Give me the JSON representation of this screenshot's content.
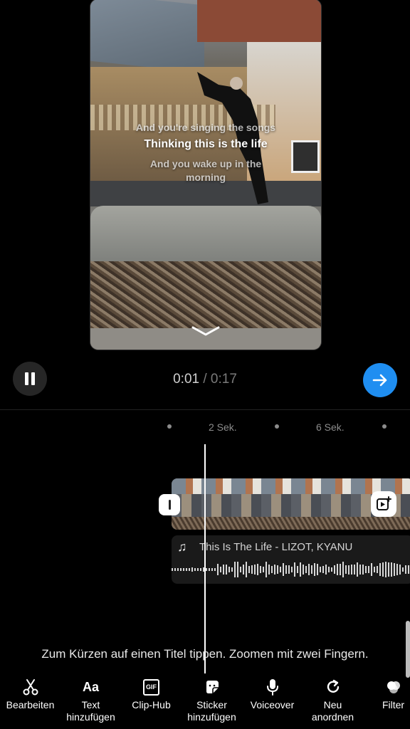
{
  "preview": {
    "lyrics": {
      "previous": "And you're singing the songs",
      "current": "Thinking this is the life",
      "next": "And you wake up in the morning"
    }
  },
  "playback": {
    "current_time": "0:01",
    "separator": "/",
    "total_time": "0:17"
  },
  "timeline": {
    "ruler_labels": [
      "2 Sek.",
      "6 Sek."
    ]
  },
  "audio_track": {
    "title": "This Is The Life - LIZOT, KYANU"
  },
  "hint_text": "Zum Kürzen auf einen Titel tippen. Zoomen mit zwei Fingern.",
  "toolbar": {
    "items": [
      {
        "label": "Bearbeiten",
        "icon": "scissors-icon"
      },
      {
        "label": "Text\nhinzufügen",
        "icon": "text-aa-icon",
        "glyph": "Aa"
      },
      {
        "label": "Clip-Hub",
        "icon": "gif-icon",
        "glyph": "GIF"
      },
      {
        "label": "Sticker\nhinzufügen",
        "icon": "sticker-icon"
      },
      {
        "label": "Voiceover",
        "icon": "microphone-icon"
      },
      {
        "label": "Neu\nanordnen",
        "icon": "reorder-icon"
      },
      {
        "label": "Filter",
        "icon": "filter-icon"
      }
    ]
  },
  "colors": {
    "accent": "#1f8ef1",
    "background": "#000000"
  }
}
